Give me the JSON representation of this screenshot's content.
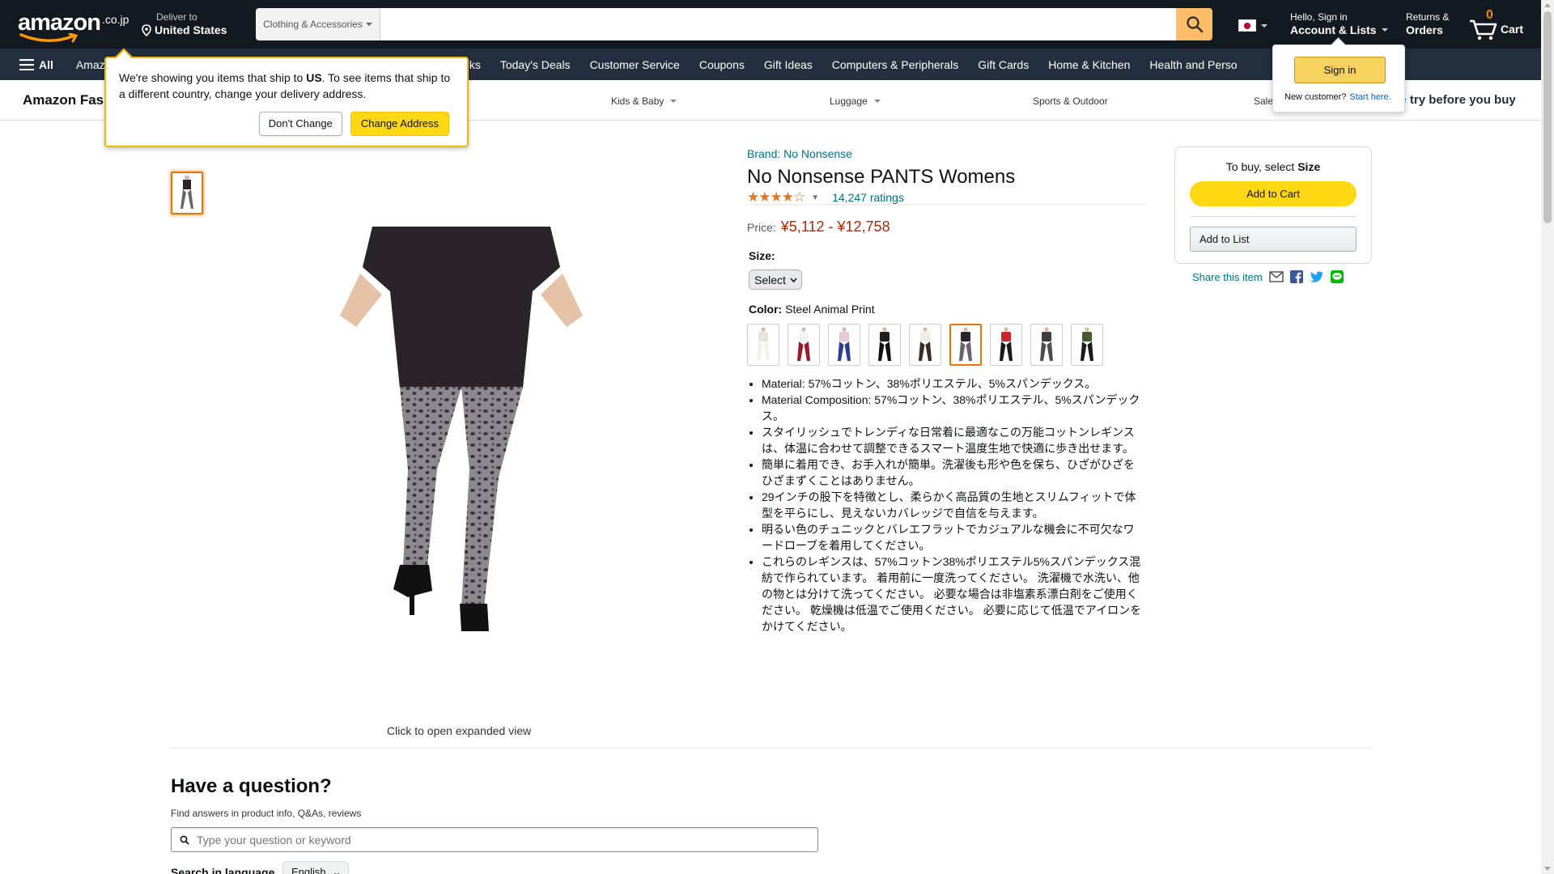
{
  "header": {
    "logo_text": "amazon",
    "logo_tld": ".co.jp",
    "deliver_line1": "Deliver to",
    "deliver_line2": "United States",
    "search_category": "Clothing & Accessories",
    "search_placeholder": "",
    "account_line1": "Hello, Sign in",
    "account_line2": "Account & Lists",
    "returns_line1": "Returns &",
    "returns_line2": "Orders",
    "cart_count": "0",
    "cart_label": "Cart"
  },
  "main_nav": {
    "all_label": "All",
    "items": [
      "Amazon",
      "se Books",
      "Today's Deals",
      "Customer Service",
      "Coupons",
      "Gift Ideas",
      "Computers & Peripherals",
      "Gift Cards",
      "Home & Kitchen",
      "Health and Perso"
    ]
  },
  "sub_nav": {
    "brand": "Amazon Fas",
    "links": [
      "Kids & Baby",
      "Luggage",
      "Sports & Outdoor",
      "Sale"
    ],
    "promo_prefix": "me",
    "promo_text": " try before you buy"
  },
  "ship_popover": {
    "text_before": "We're showing you items that ship to ",
    "country": "US",
    "text_after": ". To see items that ship to a different country, change your delivery address.",
    "dont_change": "Don't Change",
    "change_address": "Change Address"
  },
  "signin_popover": {
    "button": "Sign in",
    "new_customer": "New customer?",
    "start_here": "Start here."
  },
  "product": {
    "brand": "Brand: No Nonsense",
    "title": "No Nonsense PANTS Womens",
    "rating_value": 4.5,
    "ratings_count": "14,247 ratings",
    "price_label": "Price:",
    "price_value": "¥5,112 - ¥12,758",
    "size_label": "Size:",
    "size_value": "Select",
    "color_label": "Color:",
    "color_value": "Steel Animal Print",
    "swatches": [
      {
        "top": "#e8e4dc",
        "bottom": "#f4f1ea"
      },
      {
        "top": "#f3f3f3",
        "bottom": "#9b1b2a"
      },
      {
        "top": "#e7c9d6",
        "bottom": "#2d3f8c"
      },
      {
        "top": "#1e1e1e",
        "bottom": "#111111"
      },
      {
        "top": "#f0ece6",
        "bottom": "#3b2c22"
      },
      {
        "top": "#2a2327",
        "bottom": "#6a6470"
      },
      {
        "top": "#c9252c",
        "bottom": "#1a1a1a"
      },
      {
        "top": "#3d3d40",
        "bottom": "#4e4e52"
      },
      {
        "top": "#4a5a2a",
        "bottom": "#1a1a1a"
      }
    ],
    "selected_swatch": 5,
    "bullets": [
      "Material: 57%コットン、38%ポリエステル、5%スパンデックス。",
      "Material Composition: 57%コットン、38%ポリエステル、5%スパンデックス。",
      "スタイリッシュでトレンディな日常着に最適なこの万能コットンレギンスは、体温に合わせて調整できるスマート温度生地で快適に歩き出せます。",
      "簡単に着用でき、お手入れが簡単。洗濯後も形や色を保ち、ひざがひざをひざまずくことはありません。",
      "29インチの股下を特徴とし、柔らかく高品質の生地とスリムフィットで体型を平らにし、見えないカバレッジで自信を与えます。",
      "明るい色のチュニックとバレエフラットでカジュアルな機会に不可欠なワードローブを着用してください。",
      "これらのレギンスは、57%コットン38%ポリエステル5%スパンデックス混紡で作られています。 着用前に一度洗ってください。 洗濯機で水洗い、他の物とは分けて洗ってください。 必要な場合は非塩素系漂白剤をご使用ください。 乾燥機は低温でご使用ください。 必要に応じて低温でアイロンをかけてください。"
    ],
    "expand_text": "Click to open expanded view"
  },
  "buybox": {
    "header_prefix": "To buy, select ",
    "header_bold": "Size",
    "add_to_cart": "Add to Cart",
    "add_to_list": "Add to List",
    "share": "Share this item"
  },
  "question": {
    "title": "Have a question?",
    "subtitle": "Find answers in product info, Q&As, reviews",
    "placeholder": "Type your question or keyword",
    "lang_label": "Search in language",
    "lang_value": "English"
  },
  "colors": {
    "nav_dark": "#131921",
    "nav_main": "#232f3e",
    "accent_yellow": "#ffd814",
    "link": "#007185",
    "price": "#b12704",
    "star": "#de7921"
  }
}
